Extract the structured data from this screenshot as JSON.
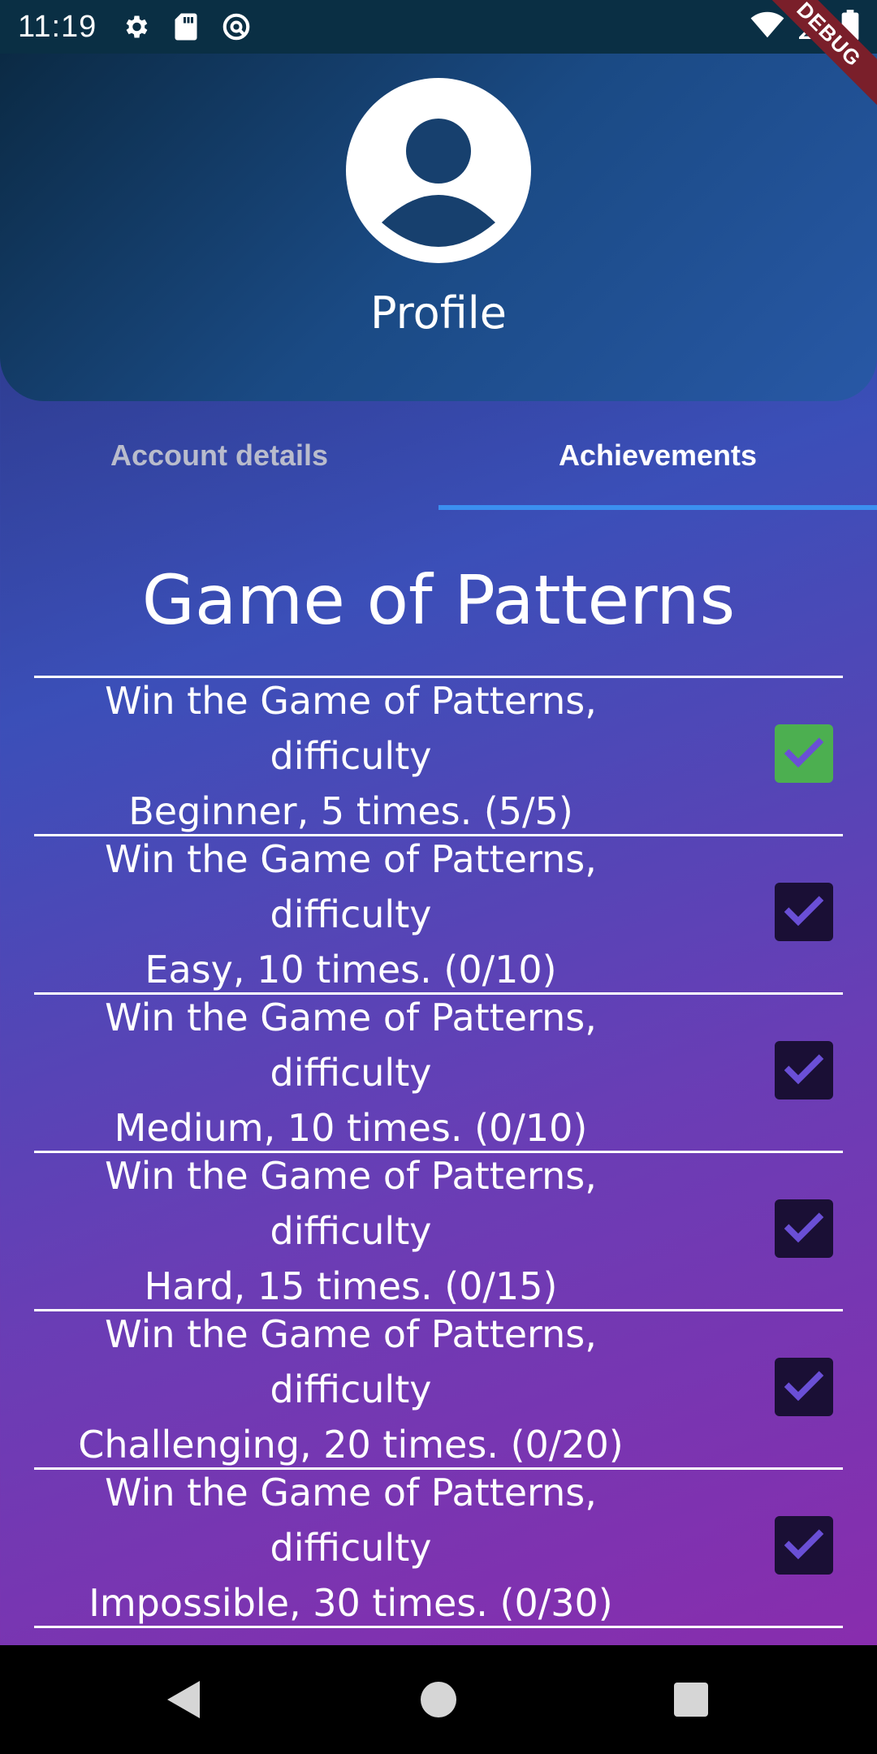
{
  "status_bar": {
    "time": "11:19",
    "icons": [
      "gear-icon",
      "sd-card-icon",
      "sync-icon",
      "wifi-icon",
      "signal-icon",
      "battery-icon"
    ]
  },
  "debug_banner": {
    "label": "DEBUG"
  },
  "header": {
    "title": "Profile",
    "avatar_icon": "account-circle-icon"
  },
  "tabs": [
    {
      "label": "Account details",
      "active": false
    },
    {
      "label": "Achievements",
      "active": true
    }
  ],
  "section": {
    "title": "Game of Patterns"
  },
  "achievements": [
    {
      "line1": "Win the Game of Patterns, difficulty",
      "line2": "Beginner, 5 times. (5/5)",
      "completed": true
    },
    {
      "line1": "Win the Game of Patterns, difficulty",
      "line2": "Easy, 10 times. (0/10)",
      "completed": false
    },
    {
      "line1": "Win the Game of Patterns, difficulty",
      "line2": "Medium, 10 times. (0/10)",
      "completed": false
    },
    {
      "line1": "Win the Game of Patterns, difficulty",
      "line2": "Hard, 15 times. (0/15)",
      "completed": false
    },
    {
      "line1": "Win the Game of Patterns, difficulty",
      "line2": "Challenging, 20 times. (0/20)",
      "completed": false
    },
    {
      "line1": "Win the Game of Patterns, difficulty",
      "line2": "Impossible, 30 times. (0/30)",
      "completed": false
    }
  ],
  "colors": {
    "checked": "#4caf50",
    "unchecked": "#1a0f35",
    "check_mark": "#6a4fd6",
    "tab_indicator": "#3b8ff0"
  },
  "nav_bar": {
    "buttons": [
      "back-icon",
      "home-icon",
      "recents-icon"
    ]
  }
}
